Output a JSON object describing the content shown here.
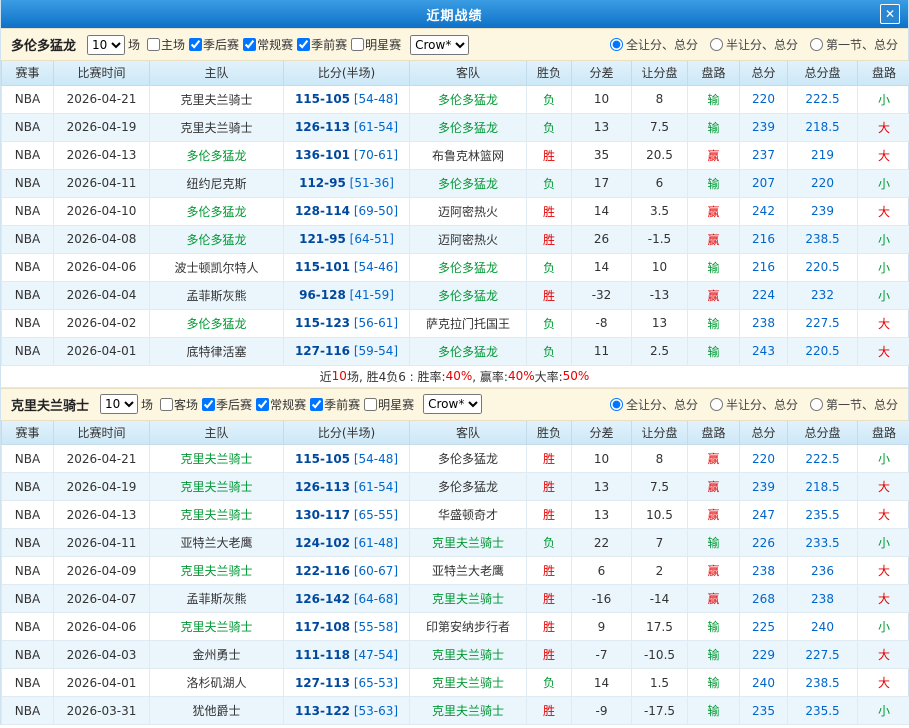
{
  "titlebar": {
    "title": "近期战绩",
    "close_glyph": "✕"
  },
  "table": {
    "columns": [
      "赛事",
      "比赛时间",
      "主队",
      "比分(半场)",
      "客队",
      "胜负",
      "分差",
      "让分盘",
      "盘路",
      "总分",
      "总分盘",
      "盘路"
    ]
  },
  "radio_options": [
    "全让分、总分",
    "半让分、总分",
    "第一节、总分"
  ],
  "sections": [
    {
      "team": "多伦多猛龙",
      "count_value": "10",
      "count_suffix": "场",
      "filters": [
        {
          "label": "主场",
          "checked": false
        },
        {
          "label": "季后赛",
          "checked": true
        },
        {
          "label": "常规赛",
          "checked": true
        },
        {
          "label": "季前赛",
          "checked": true
        },
        {
          "label": "明星赛",
          "checked": false
        }
      ],
      "source_value": "Crow*",
      "selected_radio": 0,
      "rows": [
        {
          "league": "NBA",
          "date": "2026-04-21",
          "home": "克里夫兰骑士",
          "home_hl": false,
          "score": "115-105",
          "half": "[54-48]",
          "away": "多伦多猛龙",
          "away_hl": true,
          "result": "负",
          "diff": "10",
          "handicap": "8",
          "handicap_result": "输",
          "total": "220",
          "total_line": "222.5",
          "total_result": "小"
        },
        {
          "league": "NBA",
          "date": "2026-04-19",
          "home": "克里夫兰骑士",
          "home_hl": false,
          "score": "126-113",
          "half": "[61-54]",
          "away": "多伦多猛龙",
          "away_hl": true,
          "result": "负",
          "diff": "13",
          "handicap": "7.5",
          "handicap_result": "输",
          "total": "239",
          "total_line": "218.5",
          "total_result": "大"
        },
        {
          "league": "NBA",
          "date": "2026-04-13",
          "home": "多伦多猛龙",
          "home_hl": true,
          "score": "136-101",
          "half": "[70-61]",
          "away": "布鲁克林篮网",
          "away_hl": false,
          "result": "胜",
          "diff": "35",
          "handicap": "20.5",
          "handicap_result": "赢",
          "total": "237",
          "total_line": "219",
          "total_result": "大"
        },
        {
          "league": "NBA",
          "date": "2026-04-11",
          "home": "纽约尼克斯",
          "home_hl": false,
          "score": "112-95",
          "half": "[51-36]",
          "away": "多伦多猛龙",
          "away_hl": true,
          "result": "负",
          "diff": "17",
          "handicap": "6",
          "handicap_result": "输",
          "total": "207",
          "total_line": "220",
          "total_result": "小"
        },
        {
          "league": "NBA",
          "date": "2026-04-10",
          "home": "多伦多猛龙",
          "home_hl": true,
          "score": "128-114",
          "half": "[69-50]",
          "away": "迈阿密热火",
          "away_hl": false,
          "result": "胜",
          "diff": "14",
          "handicap": "3.5",
          "handicap_result": "赢",
          "total": "242",
          "total_line": "239",
          "total_result": "大"
        },
        {
          "league": "NBA",
          "date": "2026-04-08",
          "home": "多伦多猛龙",
          "home_hl": true,
          "score": "121-95",
          "half": "[64-51]",
          "away": "迈阿密热火",
          "away_hl": false,
          "result": "胜",
          "diff": "26",
          "handicap": "-1.5",
          "handicap_result": "赢",
          "total": "216",
          "total_line": "238.5",
          "total_result": "小"
        },
        {
          "league": "NBA",
          "date": "2026-04-06",
          "home": "波士顿凯尔特人",
          "home_hl": false,
          "score": "115-101",
          "half": "[54-46]",
          "away": "多伦多猛龙",
          "away_hl": true,
          "result": "负",
          "diff": "14",
          "handicap": "10",
          "handicap_result": "输",
          "total": "216",
          "total_line": "220.5",
          "total_result": "小"
        },
        {
          "league": "NBA",
          "date": "2026-04-04",
          "home": "孟菲斯灰熊",
          "home_hl": false,
          "score": "96-128",
          "half": "[41-59]",
          "away": "多伦多猛龙",
          "away_hl": true,
          "result": "胜",
          "diff": "-32",
          "handicap": "-13",
          "handicap_result": "赢",
          "total": "224",
          "total_line": "232",
          "total_result": "小"
        },
        {
          "league": "NBA",
          "date": "2026-04-02",
          "home": "多伦多猛龙",
          "home_hl": true,
          "score": "115-123",
          "half": "[56-61]",
          "away": "萨克拉门托国王",
          "away_hl": false,
          "result": "负",
          "diff": "-8",
          "handicap": "13",
          "handicap_result": "输",
          "total": "238",
          "total_line": "227.5",
          "total_result": "大"
        },
        {
          "league": "NBA",
          "date": "2026-04-01",
          "home": "底特律活塞",
          "home_hl": false,
          "score": "127-116",
          "half": "[59-54]",
          "away": "多伦多猛龙",
          "away_hl": true,
          "result": "负",
          "diff": "11",
          "handicap": "2.5",
          "handicap_result": "输",
          "total": "243",
          "total_line": "220.5",
          "total_result": "大"
        }
      ],
      "summary_segments": [
        {
          "t": "近 ",
          "c": "dark"
        },
        {
          "t": "10",
          "c": "red"
        },
        {
          "t": " 场, 胜4负6 : 胜率: ",
          "c": "dark"
        },
        {
          "t": "40%",
          "c": "red"
        },
        {
          "t": ", 赢率: ",
          "c": "dark"
        },
        {
          "t": "40%",
          "c": "red"
        },
        {
          "t": " 大率: ",
          "c": "dark"
        },
        {
          "t": "50%",
          "c": "red"
        }
      ]
    },
    {
      "team": "克里夫兰骑士",
      "count_value": "10",
      "count_suffix": "场",
      "filters": [
        {
          "label": "客场",
          "checked": false
        },
        {
          "label": "季后赛",
          "checked": true
        },
        {
          "label": "常规赛",
          "checked": true
        },
        {
          "label": "季前赛",
          "checked": true
        },
        {
          "label": "明星赛",
          "checked": false
        }
      ],
      "source_value": "Crow*",
      "selected_radio": 0,
      "rows": [
        {
          "league": "NBA",
          "date": "2026-04-21",
          "home": "克里夫兰骑士",
          "home_hl": true,
          "score": "115-105",
          "half": "[54-48]",
          "away": "多伦多猛龙",
          "away_hl": false,
          "result": "胜",
          "diff": "10",
          "handicap": "8",
          "handicap_result": "赢",
          "total": "220",
          "total_line": "222.5",
          "total_result": "小"
        },
        {
          "league": "NBA",
          "date": "2026-04-19",
          "home": "克里夫兰骑士",
          "home_hl": true,
          "score": "126-113",
          "half": "[61-54]",
          "away": "多伦多猛龙",
          "away_hl": false,
          "result": "胜",
          "diff": "13",
          "handicap": "7.5",
          "handicap_result": "赢",
          "total": "239",
          "total_line": "218.5",
          "total_result": "大"
        },
        {
          "league": "NBA",
          "date": "2026-04-13",
          "home": "克里夫兰骑士",
          "home_hl": true,
          "score": "130-117",
          "half": "[65-55]",
          "away": "华盛顿奇才",
          "away_hl": false,
          "result": "胜",
          "diff": "13",
          "handicap": "10.5",
          "handicap_result": "赢",
          "total": "247",
          "total_line": "235.5",
          "total_result": "大"
        },
        {
          "league": "NBA",
          "date": "2026-04-11",
          "home": "亚特兰大老鹰",
          "home_hl": false,
          "score": "124-102",
          "half": "[61-48]",
          "away": "克里夫兰骑士",
          "away_hl": true,
          "result": "负",
          "diff": "22",
          "handicap": "7",
          "handicap_result": "输",
          "total": "226",
          "total_line": "233.5",
          "total_result": "小"
        },
        {
          "league": "NBA",
          "date": "2026-04-09",
          "home": "克里夫兰骑士",
          "home_hl": true,
          "score": "122-116",
          "half": "[60-67]",
          "away": "亚特兰大老鹰",
          "away_hl": false,
          "result": "胜",
          "diff": "6",
          "handicap": "2",
          "handicap_result": "赢",
          "total": "238",
          "total_line": "236",
          "total_result": "大"
        },
        {
          "league": "NBA",
          "date": "2026-04-07",
          "home": "孟菲斯灰熊",
          "home_hl": false,
          "score": "126-142",
          "half": "[64-68]",
          "away": "克里夫兰骑士",
          "away_hl": true,
          "result": "胜",
          "diff": "-16",
          "handicap": "-14",
          "handicap_result": "赢",
          "total": "268",
          "total_line": "238",
          "total_result": "大"
        },
        {
          "league": "NBA",
          "date": "2026-04-06",
          "home": "克里夫兰骑士",
          "home_hl": true,
          "score": "117-108",
          "half": "[55-58]",
          "away": "印第安纳步行者",
          "away_hl": false,
          "result": "胜",
          "diff": "9",
          "handicap": "17.5",
          "handicap_result": "输",
          "total": "225",
          "total_line": "240",
          "total_result": "小"
        },
        {
          "league": "NBA",
          "date": "2026-04-03",
          "home": "金州勇士",
          "home_hl": false,
          "score": "111-118",
          "half": "[47-54]",
          "away": "克里夫兰骑士",
          "away_hl": true,
          "result": "胜",
          "diff": "-7",
          "handicap": "-10.5",
          "handicap_result": "输",
          "total": "229",
          "total_line": "227.5",
          "total_result": "大"
        },
        {
          "league": "NBA",
          "date": "2026-04-01",
          "home": "洛杉矶湖人",
          "home_hl": false,
          "score": "127-113",
          "half": "[65-53]",
          "away": "克里夫兰骑士",
          "away_hl": true,
          "result": "负",
          "diff": "14",
          "handicap": "1.5",
          "handicap_result": "输",
          "total": "240",
          "total_line": "238.5",
          "total_result": "大"
        },
        {
          "league": "NBA",
          "date": "2026-03-31",
          "home": "犹他爵士",
          "home_hl": false,
          "score": "113-122",
          "half": "[53-63]",
          "away": "克里夫兰骑士",
          "away_hl": true,
          "result": "胜",
          "diff": "-9",
          "handicap": "-17.5",
          "handicap_result": "输",
          "total": "235",
          "total_line": "235.5",
          "total_result": "小"
        }
      ]
    }
  ]
}
